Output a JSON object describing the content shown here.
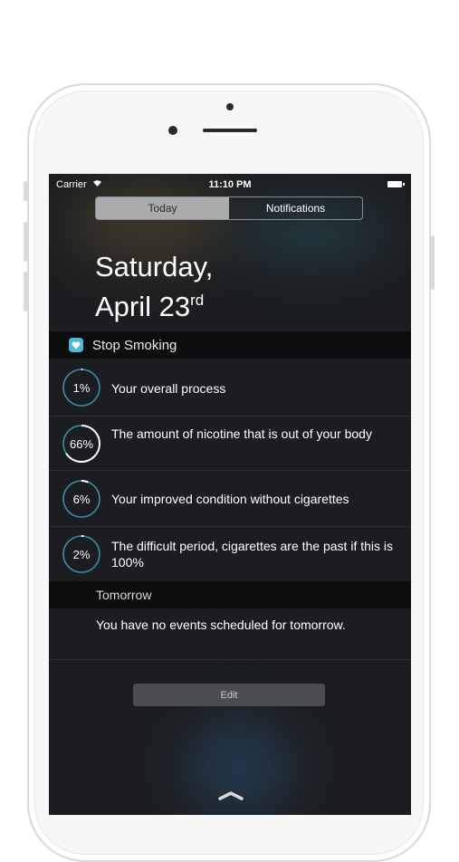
{
  "status_bar": {
    "carrier": "Carrier",
    "time": "11:10 PM"
  },
  "tabs": [
    {
      "label": "Today",
      "active": true
    },
    {
      "label": "Notifications",
      "active": false
    }
  ],
  "date": {
    "line1": "Saturday,",
    "line2": "April 23",
    "suffix": "rd"
  },
  "widget": {
    "title": "Stop Smoking",
    "icon": "heart-app-icon",
    "accent_color": "#4db8d9",
    "items": [
      {
        "percent": 1,
        "label": "1%",
        "text": "Your overall process"
      },
      {
        "percent": 66,
        "label": "66%",
        "text": "The amount of nicotine that is out of your body"
      },
      {
        "percent": 6,
        "label": "6%",
        "text": "Your improved condition without cigarettes"
      },
      {
        "percent": 2,
        "label": "2%",
        "text": "The difficult period, cigarettes are the past if this is 100%"
      }
    ]
  },
  "tomorrow": {
    "title": "Tomorrow",
    "message": "You have no events scheduled for tomorrow."
  },
  "edit_button": {
    "label": "Edit"
  }
}
